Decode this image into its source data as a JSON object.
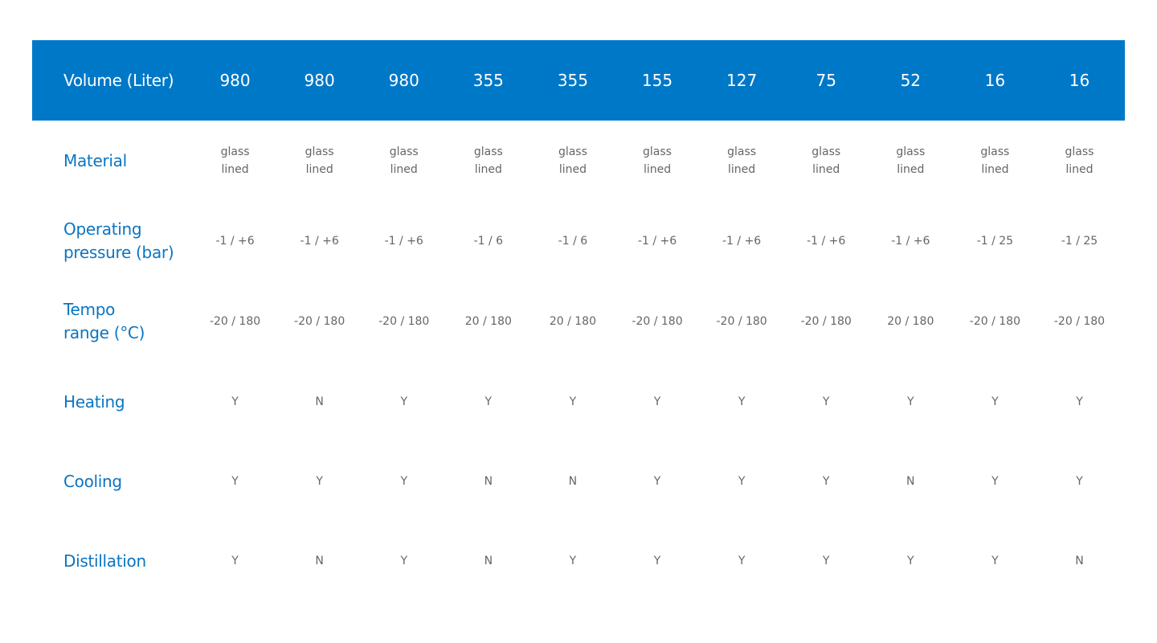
{
  "table": {
    "header": {
      "label": "Volume (Liter)",
      "values": [
        "980",
        "980",
        "980",
        "355",
        "355",
        "155",
        "127",
        "75",
        "52",
        "16",
        "16"
      ]
    },
    "rows": [
      {
        "key": "material",
        "label": "Material",
        "values": [
          [
            "glass",
            "lined"
          ],
          [
            "glass",
            "lined"
          ],
          [
            "glass",
            "lined"
          ],
          [
            "glass",
            "lined"
          ],
          [
            "glass",
            "lined"
          ],
          [
            "glass",
            "lined"
          ],
          [
            "glass",
            "lined"
          ],
          [
            "glass",
            "lined"
          ],
          [
            "glass",
            "lined"
          ],
          [
            "glass",
            "lined"
          ],
          [
            "glass",
            "lined"
          ]
        ]
      },
      {
        "key": "pressure",
        "label_lines": [
          "Operating",
          "pressure (bar)"
        ],
        "values": [
          "-1 / +6",
          "-1 / +6",
          "-1 / +6",
          "-1 / 6",
          "-1 / 6",
          "-1 / +6",
          "-1 / +6",
          "-1 / +6",
          "-1 / +6",
          "-1 / 25",
          "-1 / 25"
        ]
      },
      {
        "key": "temp",
        "label_lines": [
          "Tempo",
          "range (°C)"
        ],
        "values": [
          "-20 / 180",
          "-20 / 180",
          "-20 / 180",
          "20 / 180",
          "20 / 180",
          "-20 / 180",
          "-20 / 180",
          "-20 / 180",
          "20 / 180",
          "-20 / 180",
          "-20 / 180"
        ]
      },
      {
        "key": "heating",
        "label": "Heating",
        "values": [
          "Y",
          "N",
          "Y",
          "Y",
          "Y",
          "Y",
          "Y",
          "Y",
          "Y",
          "Y",
          "Y"
        ]
      },
      {
        "key": "cooling",
        "label": "Cooling",
        "values": [
          "Y",
          "Y",
          "Y",
          "N",
          "N",
          "Y",
          "Y",
          "Y",
          "N",
          "Y",
          "Y"
        ]
      },
      {
        "key": "distillation",
        "label": "Distillation",
        "values": [
          "Y",
          "N",
          "Y",
          "N",
          "Y",
          "Y",
          "Y",
          "Y",
          "Y",
          "Y",
          "N"
        ]
      }
    ]
  },
  "colors": {
    "header_bg": "#0078c8",
    "header_text": "#ffffff",
    "label_text": "#0a75c2",
    "value_text": "#666666"
  }
}
